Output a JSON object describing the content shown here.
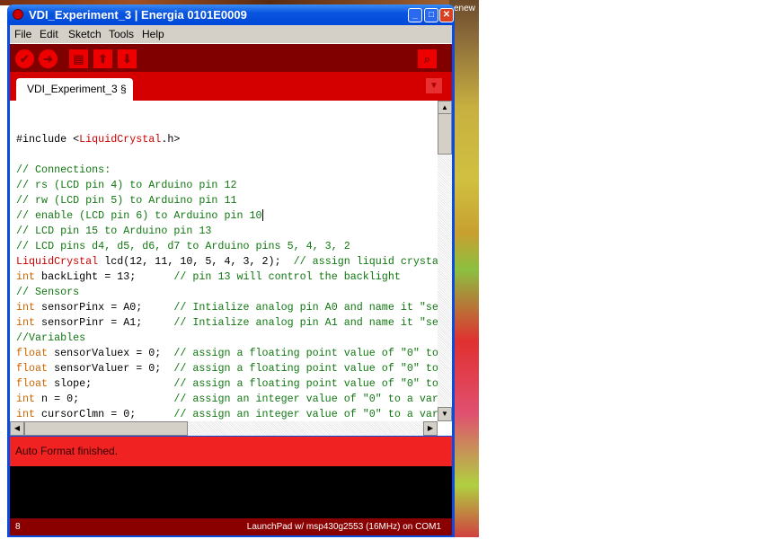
{
  "window": {
    "title": "VDI_Experiment_3 | Energia 0101E0009",
    "desktop_label": "enew"
  },
  "menu": [
    "File",
    "Edit",
    "Sketch",
    "Tools",
    "Help"
  ],
  "toolbar": {
    "buttons": [
      "verify-icon",
      "upload-icon",
      "new-icon",
      "open-icon",
      "save-icon"
    ],
    "serial": "serial-monitor-icon"
  },
  "tab": {
    "label": "VDI_Experiment_3 §"
  },
  "code": [
    [],
    [
      [
        "pl",
        "#include <"
      ],
      [
        "cls",
        "LiquidCrystal"
      ],
      [
        "pl",
        ".h>"
      ]
    ],
    [],
    [
      [
        "cm",
        "// Connections:"
      ]
    ],
    [
      [
        "cm",
        "// rs (LCD pin 4) to Arduino pin 12"
      ]
    ],
    [
      [
        "cm",
        "// rw (LCD pin 5) to Arduino pin 11"
      ]
    ],
    [
      [
        "cm",
        "// enable (LCD pin 6) to Arduino pin 10"
      ]
    ],
    [
      [
        "cm",
        "// LCD pin 15 to Arduino pin 13"
      ]
    ],
    [
      [
        "cm",
        "// LCD pins d4, d5, d6, d7 to Arduino pins 5, 4, 3, 2"
      ]
    ],
    [
      [
        "cls",
        "LiquidCrystal"
      ],
      [
        "pl",
        " lcd(12, 11, 10, 5, 4, 3, 2);  "
      ],
      [
        "cm",
        "// assign liquid crysta"
      ]
    ],
    [
      [
        "kw",
        "int"
      ],
      [
        "pl",
        " backLight = 13;      "
      ],
      [
        "cm",
        "// pin 13 will control the backlight"
      ]
    ],
    [
      [
        "cm",
        "// Sensors"
      ]
    ],
    [
      [
        "kw",
        "int"
      ],
      [
        "pl",
        " sensorPinx = A0;     "
      ],
      [
        "cm",
        "// Intialize analog pin A0 and name it \"se"
      ]
    ],
    [
      [
        "kw",
        "int"
      ],
      [
        "pl",
        " sensorPinr = A1;     "
      ],
      [
        "cm",
        "// Intialize analog pin A1 and name it \"se"
      ]
    ],
    [
      [
        "cm",
        "//Variables"
      ]
    ],
    [
      [
        "kw",
        "float"
      ],
      [
        "pl",
        " sensorValuex = 0;  "
      ],
      [
        "cm",
        "// assign a floating point value of \"0\" to"
      ]
    ],
    [
      [
        "kw",
        "float"
      ],
      [
        "pl",
        " sensorValuer = 0;  "
      ],
      [
        "cm",
        "// assign a floating point value of \"0\" to"
      ]
    ],
    [
      [
        "kw",
        "float"
      ],
      [
        "pl",
        " slope;             "
      ],
      [
        "cm",
        "// assign a floating point value of \"0\" to"
      ]
    ],
    [
      [
        "kw",
        "int"
      ],
      [
        "pl",
        " n = 0;               "
      ],
      [
        "cm",
        "// assign an integer value of \"0\" to a var"
      ]
    ],
    [
      [
        "kw",
        "int"
      ],
      [
        "pl",
        " cursorClmn = 0;      "
      ],
      [
        "cm",
        "// assign an integer value of \"0\" to a var"
      ]
    ]
  ],
  "status": {
    "message": "Auto Format finished."
  },
  "footer": {
    "line": "8",
    "board": "LaunchPad w/ msp430g2553 (16MHz) on COM1"
  }
}
